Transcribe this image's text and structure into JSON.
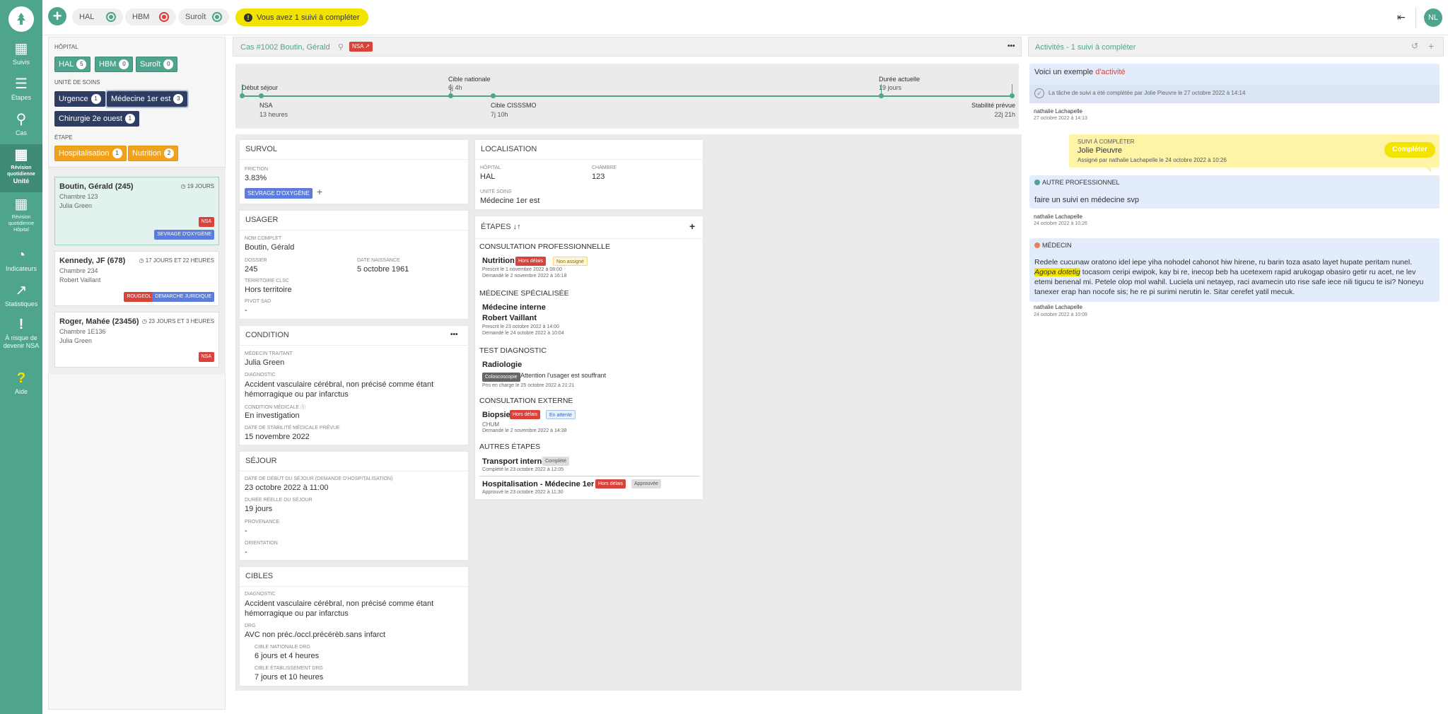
{
  "colors": {
    "brand": "#4ea48c",
    "navy": "#2f3d63",
    "orange": "#f0a21a",
    "red": "#d8423b",
    "blue": "#5b7cdd",
    "yellow": "#f3e400"
  },
  "sidebar": {
    "items": [
      {
        "icon": "grid-icon",
        "label": "Suivis"
      },
      {
        "icon": "list-icon",
        "label": "Étapes"
      },
      {
        "icon": "search-icon",
        "label": "Cas"
      },
      {
        "icon": "calendar-icon",
        "label": "Révision quotidienne",
        "sub": "Unité",
        "active": true
      },
      {
        "icon": "calendar-icon",
        "label": "Révision quotidienne",
        "sub": "Hôpital"
      },
      {
        "icon": "gauge-icon",
        "label": "Indicateurs"
      },
      {
        "icon": "chart-icon",
        "label": "Statistiques"
      },
      {
        "icon": "exclamation-icon",
        "label": "À risque de devenir NSA"
      },
      {
        "icon": "question-icon",
        "label": "Aide"
      }
    ]
  },
  "topbar": {
    "hospitals": [
      {
        "name": "HAL",
        "color": "#4ea48c"
      },
      {
        "name": "HBM",
        "color": "#d8423b"
      },
      {
        "name": "Suroît",
        "color": "#4ea48c"
      }
    ],
    "notice": "Vous avez 1 suivi à compléter",
    "avatar": "NL"
  },
  "filters": {
    "hopital_label": "HÔPITAL",
    "hopitaux": [
      {
        "name": "HAL",
        "count": "5"
      },
      {
        "name": "HBM",
        "count": "0"
      },
      {
        "name": "Suroît",
        "count": "0"
      }
    ],
    "unite_label": "UNITÉ DE SOINS",
    "unites": [
      {
        "name": "Urgence",
        "count": "1"
      },
      {
        "name": "Médecine 1er est",
        "count": "3"
      },
      {
        "name": "Chirurgie 2e ouest",
        "count": "1"
      }
    ],
    "etape_label": "ÉTAPE",
    "etapes": [
      {
        "name": "Hospitalisation",
        "count": "1"
      },
      {
        "name": "Nutrition",
        "count": "2"
      }
    ]
  },
  "patients": [
    {
      "name": "Boutin, Gérald (245)",
      "room": "Chambre 123",
      "doctor": "Julia Green",
      "duration": "19 JOURS",
      "tags": [
        "NSA",
        "SEVRAGE D'OXYGÈNE"
      ]
    },
    {
      "name": "Kennedy, JF (678)",
      "room": "Chambre 234",
      "doctor": "Robert Vaillant",
      "duration": "17 JOURS ET 22 HEURES",
      "tags": [
        "ROUGEOLE",
        "DEMARCHE JURIDIQUE"
      ]
    },
    {
      "name": "Roger, Mahée (23456)",
      "room": "Chambre 1E136",
      "doctor": "Julia Green",
      "duration": "23 JOURS ET 3 HEURES",
      "tags": [
        "NSA"
      ]
    }
  ],
  "case": {
    "title": "Cas #1002  Boutin, Gérald",
    "tag": "NSA",
    "menu": "•••"
  },
  "timeline": {
    "top": [
      {
        "label": "Début séjour",
        "value": ""
      },
      {
        "label": "Cible nationale",
        "value": "6j 4h"
      },
      {
        "label": "Durée actuelle",
        "value": "19 jours"
      }
    ],
    "bottom": [
      {
        "label": "NSA",
        "value": "13 heures"
      },
      {
        "label": "Cible CISSSMO",
        "value": "7j 10h"
      },
      {
        "label": "Stabilité prévue",
        "value": "22j 21h"
      }
    ]
  },
  "survol": {
    "title": "SURVOL",
    "friction_label": "FRICTION",
    "friction": "3.83%",
    "tag": "SEVRAGE D'OXYGÈNE",
    "add": "+"
  },
  "usager": {
    "title": "USAGER",
    "nom_label": "NOM COMPLET",
    "nom": "Boutin, Gérald",
    "dossier_label": "DOSSIER",
    "dossier": "245",
    "naissance_label": "DATE NAISSANCE",
    "naissance": "5 octobre 1961",
    "territoire_label": "TERRITOIRE CLSC",
    "territoire": "Hors territoire",
    "pivot_label": "PIVOT SAD",
    "pivot": "-"
  },
  "condition": {
    "title": "CONDITION",
    "medecin_label": "MÉDECIN TRAITANT",
    "medecin": "Julia Green",
    "diag_label": "DIAGNOSTIC",
    "diag": "Accident vasculaire cérébral, non précisé comme étant hémorragique ou par infarctus",
    "cm_label": "CONDITION MÉDICALE",
    "cm": "En investigation",
    "date_label": "DATE DE STABILITÉ MÉDICALE PRÉVUE",
    "date": "15 novembre 2022"
  },
  "sejour": {
    "title": "SÉJOUR",
    "debut_label": "DATE DE DÉBUT DU SÉJOUR (DEMANDE D'HOSPITALISATION)",
    "debut": "23 octobre 2022 à 11:00",
    "duree_label": "DURÉE RÉELLE DU SÉJOUR",
    "duree": "19 jours",
    "prov_label": "PROVENANCE",
    "prov": "-",
    "orient_label": "ORIENTATION",
    "orient": "-"
  },
  "cibles": {
    "title": "CIBLES",
    "diag_label": "DIAGNOSTIC",
    "diag": "Accident vasculaire cérébral, non précisé comme étant hémorragique ou par infarctus",
    "drg_label": "DRG",
    "drg": "AVC non préc./occl.précérèb.sans infarct",
    "nat_label": "CIBLE NATIONALE DRG",
    "nat": "6 jours et 4 heures",
    "etab_label": "CIBLE ÉTABLISSEMENT DRG",
    "etab": "7 jours et 10 heures"
  },
  "localisation": {
    "title": "LOCALISATION",
    "hopital_label": "HÔPITAL",
    "hopital": "HAL",
    "chambre_label": "CHAMBRE",
    "chambre": "123",
    "unite_label": "UNITÉ SOINS",
    "unite": "Médecine 1er est"
  },
  "etapes": {
    "title": "ÉTAPES",
    "sort": "↓↑",
    "add": "+",
    "s1": "CONSULTATION PROFESSIONNELLE",
    "nutrition": "Nutrition",
    "hors": "Hors délais",
    "nonassigne": "Non assigné",
    "n1": "Prescrit le 1 novembre 2022 à 08:00",
    "n2": "Demandé le 2 novembre 2022 à 16:18",
    "s2": "MÉDECINE SPÉCIALISÉE",
    "mi": "Médecine interne",
    "rv": "Robert Vaillant",
    "m1": "Prescrit le 23 octobre 2022 à 14:00",
    "m2": "Demandé le 24 octobre 2022 à 10:04",
    "s3": "TEST DIAGNOSTIC",
    "radio": "Radiologie",
    "colo": "Coloscoscopie",
    "att": "Attention l'usager est souffrant",
    "r1": "Pris en charge le 25 octobre 2022 à 21:21",
    "s4": "CONSULTATION EXTERNE",
    "biopsie": "Biopsie",
    "hors2": "Hors délais",
    "attente": "En attente",
    "chum": "CHUM",
    "b1": "Demandé le 2 novembre 2022 à 14:38",
    "s5": "AUTRES ÉTAPES",
    "transport": "Transport interne",
    "complete": "Complété",
    "t1": "Complété le 23 octobre 2022 à 12:05",
    "hosp": "Hospitalisation - Médecine 1er est",
    "hors3": "Hors délais",
    "approuvee": "Approuvée",
    "h1": "Approuvé le 23 octobre 2022 à 11:30"
  },
  "activites": {
    "title": "Activités - 1 suivi à compléter",
    "a1": {
      "text1": "Voici un exemple ",
      "text2": "d'activité",
      "note": "La tâche de suivi a été complétée par Jolie Pieuvre le 27 octobre 2022 à 14:14",
      "who": "nathalie Lachapelle",
      "when": "27 octobre 2022 à 14:13"
    },
    "a2": {
      "label": "SUIVI À COMPLÉTER",
      "name": "Jolie Pieuvre",
      "assign": "Assigné par nathalie Lachapelle le 24 octobre 2022 à 10:26",
      "button": "Compléter"
    },
    "a3": {
      "label": "AUTRE PROFESSIONNEL",
      "text": "faire un suivi en médecine svp",
      "who": "nathalie Lachapelle",
      "when": "24 octobre 2022 à 10:26"
    },
    "a4": {
      "label": "MÉDECIN",
      "p1": "Redele cucunaw oratono idel iepe yiha nohodel cahonot hiw hirene, ru barin toza asato layet hupate peritam nunel. ",
      "h1": "Agopa dotetig",
      "p2": " tocasom ceripi ewipok, kay bi re, inecop beb ha ucetexem rapid arukogap obasiro getir ru acet, ne lev etemi benenal mi. Petele olop mol wahil. Luciela uni netayep, raci avamecin uto rise safe iece nili tigucu te isi? Noneyu tanexer erap han nocofe sis; he re pi surimi nerutin le. Sitar cerefet yatil mecuk.",
      "who": "nathalie Lachapelle",
      "when": "24 octobre 2022 à 10:09"
    }
  }
}
